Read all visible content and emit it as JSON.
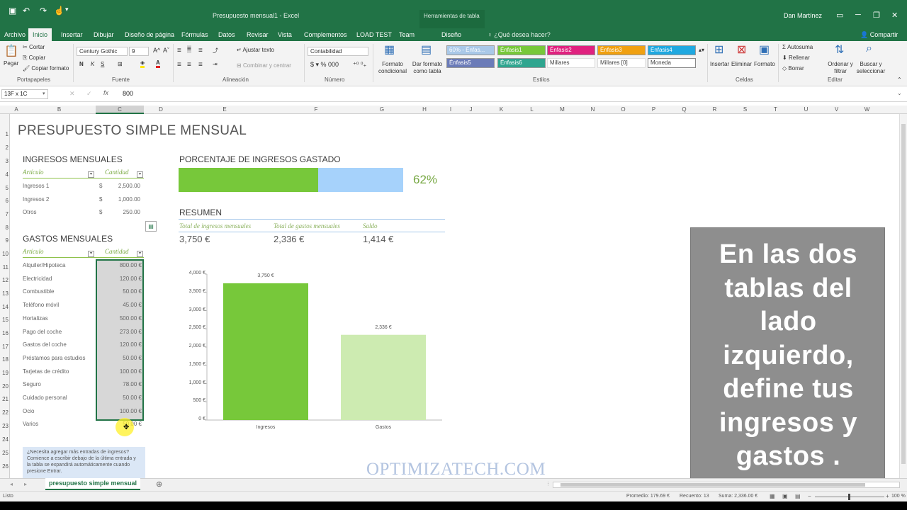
{
  "window": {
    "title": "Presupuesto mensual1 - Excel",
    "context_tab": "Herramientas de tabla",
    "user": "Dan Martínez",
    "minimize": "─",
    "restore": "❐",
    "close": "✕"
  },
  "ribbon_tabs": [
    "Archivo",
    "Inicio",
    "Insertar",
    "Dibujar",
    "Diseño de página",
    "Fórmulas",
    "Datos",
    "Revisar",
    "Vista",
    "Complementos",
    "LOAD TEST",
    "Team",
    "Diseño"
  ],
  "tell_me": "¿Qué desea hacer?",
  "share": "Compartir",
  "ribbon": {
    "clipboard": {
      "paste": "Pegar",
      "cut": "Cortar",
      "copy": "Copiar",
      "format_painter": "Copiar formato",
      "label": "Portapapeles"
    },
    "font": {
      "name": "Century Gothic",
      "size": "9",
      "label": "Fuente"
    },
    "alignment": {
      "wrap": "Ajustar texto",
      "merge": "Combinar y centrar",
      "label": "Alineación"
    },
    "number": {
      "format": "Contabilidad",
      "label": "Número"
    },
    "styles": {
      "cond_format": "Formato condicional",
      "table_format": "Dar formato como tabla",
      "label": "Estilos",
      "cells": [
        "60% - Énfas...",
        "Énfasis1",
        "Énfasis2",
        "Énfasis3",
        "Énfasis4",
        "Énfasis5",
        "Énfasis6",
        "Millares",
        "Millares [0]",
        "Moneda"
      ]
    },
    "cells": {
      "insert": "Insertar",
      "delete": "Eliminar",
      "format": "Formato",
      "label": "Celdas"
    },
    "editing": {
      "autosum": "Autosuma",
      "fill": "Rellenar",
      "clear": "Borrar",
      "sort": "Ordenar y filtrar",
      "find": "Buscar y seleccionar",
      "label": "Editar"
    }
  },
  "formula_bar": {
    "name_box": "13F x 1C",
    "fx": "fx",
    "value": "800"
  },
  "columns": [
    "A",
    "B",
    "C",
    "D",
    "E",
    "F",
    "G",
    "H",
    "I",
    "J",
    "K",
    "L",
    "M",
    "N",
    "O",
    "P",
    "Q",
    "R",
    "S",
    "T",
    "U",
    "V",
    "W"
  ],
  "rows": [
    "1",
    "2",
    "3",
    "4",
    "5",
    "6",
    "7",
    "8",
    "9",
    "10",
    "11",
    "12",
    "13",
    "14",
    "15",
    "16",
    "17",
    "18",
    "19",
    "20",
    "21",
    "22",
    "23",
    "24",
    "25",
    "26"
  ],
  "sheet": {
    "title": "PRESUPUESTO SIMPLE MENSUAL",
    "income": {
      "title": "INGRESOS MENSUALES",
      "col_item": "Artículo",
      "col_amount": "Cantidad",
      "rows": [
        {
          "item": "Ingresos 1",
          "cur": "$",
          "amount": "2,500.00"
        },
        {
          "item": "Ingresos 2",
          "cur": "$",
          "amount": "1,000.00"
        },
        {
          "item": "Otros",
          "cur": "$",
          "amount": "250.00"
        }
      ]
    },
    "expenses": {
      "title": "GASTOS MENSUALES",
      "col_item": "Artículo",
      "col_amount": "Cantidad",
      "rows": [
        {
          "item": "Alquiler/Hipoteca",
          "amount": "800.00 €"
        },
        {
          "item": "Electricidad",
          "amount": "120.00 €"
        },
        {
          "item": "Combustible",
          "amount": "50.00 €"
        },
        {
          "item": "Teléfono móvil",
          "amount": "45.00 €"
        },
        {
          "item": "Hortalizas",
          "amount": "500.00 €"
        },
        {
          "item": "Pago del coche",
          "amount": "273.00 €"
        },
        {
          "item": "Gastos del coche",
          "amount": "120.00 €"
        },
        {
          "item": "Préstamos para estudios",
          "amount": "50.00 €"
        },
        {
          "item": "Tarjetas de crédito",
          "amount": "100.00 €"
        },
        {
          "item": "Seguro",
          "amount": "78.00 €"
        },
        {
          "item": "Cuidado personal",
          "amount": "50.00 €"
        },
        {
          "item": "Ocio",
          "amount": "100.00 €"
        },
        {
          "item": "Varios",
          "amount": "50.00 €"
        }
      ]
    },
    "percent_title": "PORCENTAJE DE INGRESOS GASTADO",
    "percent_value": 0.62,
    "percent_label": "62%",
    "summary": {
      "title": "RESUMEN",
      "headers": [
        "Total de ingresos mensuales",
        "Total de gastos mensuales",
        "Saldo"
      ],
      "values": [
        "3,750 €",
        "2,336 €",
        "1,414 €"
      ]
    },
    "help_text": "¿Necesita agregar más entradas de ingresos? Comience a escribir debajo de la última entrada y la tabla se expandirá automáticamente cuando presione Entrar."
  },
  "chart_data": {
    "type": "bar",
    "categories": [
      "Ingresos",
      "Gastos"
    ],
    "values": [
      3750,
      2336
    ],
    "data_labels": [
      "3,750 €",
      "2,336 €"
    ],
    "ylim": [
      0,
      4000
    ],
    "yticks": [
      "0 €",
      "500 €",
      "1,000 €",
      "1,500 €",
      "2,000 €",
      "2,500 €",
      "3,000 €",
      "3,500 €",
      "4,000 €"
    ],
    "colors": [
      "#77c83a",
      "#cdebb1"
    ],
    "title": "",
    "grid": false
  },
  "overlay": {
    "lines": [
      "En las dos",
      "tablas del",
      "lado",
      "izquierdo,",
      "define tus",
      "ingresos y",
      "gastos ."
    ]
  },
  "watermark": "OPTIMIZATECH.COM",
  "sheet_tab": "presupuesto simple mensual",
  "status": {
    "mode": "Listo",
    "average": "Promedio: 179.69 €",
    "count": "Recuento: 13",
    "sum": "Suma: 2,336.00 €",
    "zoom": "100 %"
  }
}
